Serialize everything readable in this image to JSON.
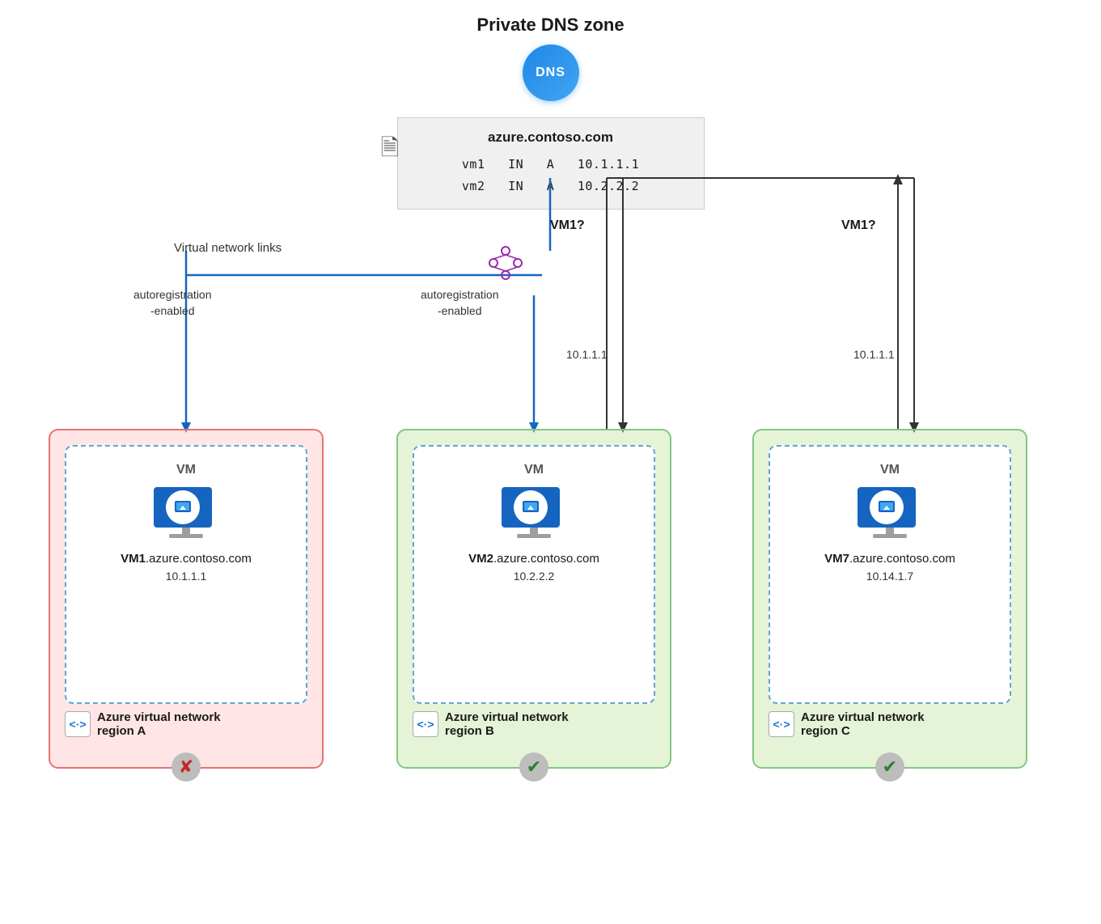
{
  "title": "Private DNS zone",
  "dns_icon_label": "DNS",
  "dns_zone": "azure.contoso.com",
  "dns_records": [
    {
      "name": "vm1",
      "class": "IN",
      "type": "A",
      "ip": "10.1.1.1"
    },
    {
      "name": "vm2",
      "class": "IN",
      "type": "A",
      "ip": "10.2.2.2"
    }
  ],
  "vnet_links_label": "Virtual network links",
  "autoregistration_labels": [
    "autoregistration -enabled",
    "autoregistration -enabled"
  ],
  "query_labels": [
    "VM1?",
    "VM1?"
  ],
  "ip_response_labels": [
    "10.1.1.1",
    "10.1.1.1"
  ],
  "regions": [
    {
      "id": "a",
      "vm_label": "VM",
      "vm_name_bold": "VM1",
      "vm_name_suffix": ".azure.contoso.com",
      "vm_ip": "10.1.1.1",
      "region_name": "Azure virtual network region A",
      "status": "error"
    },
    {
      "id": "b",
      "vm_label": "VM",
      "vm_name_bold": "VM2",
      "vm_name_suffix": ".azure.contoso.com",
      "vm_ip": "10.2.2.2",
      "region_name": "Azure virtual network region B",
      "status": "success"
    },
    {
      "id": "c",
      "vm_label": "VM",
      "vm_name_bold": "VM7",
      "vm_name_suffix": ".azure.contoso.com",
      "vm_ip": "10.14.1.7",
      "region_name": "Azure virtual network region C",
      "status": "success"
    }
  ]
}
